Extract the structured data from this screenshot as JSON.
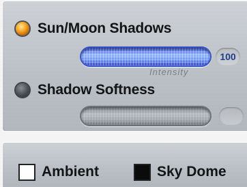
{
  "lighting": {
    "sun_moon_shadows": {
      "label": "Sun/Moon Shadows",
      "enabled": true,
      "intensity_label": "Intensity",
      "intensity_value": "100",
      "slider_level": 1.0,
      "led_icon": "led-on-icon"
    },
    "shadow_softness": {
      "label": "Shadow Softness",
      "enabled": false,
      "slider_level": 1.0,
      "led_icon": "led-off-icon"
    }
  },
  "options": {
    "ambient": {
      "label": "Ambient",
      "checked": false
    },
    "sky_dome": {
      "label": "Sky Dome",
      "checked": true
    }
  },
  "colors": {
    "led_on": "#f5a623",
    "led_off": "#4b5055",
    "slider_active": "#6d93f2",
    "slider_inactive": "#a3a8ad",
    "value_text": "#1e3c8c"
  }
}
